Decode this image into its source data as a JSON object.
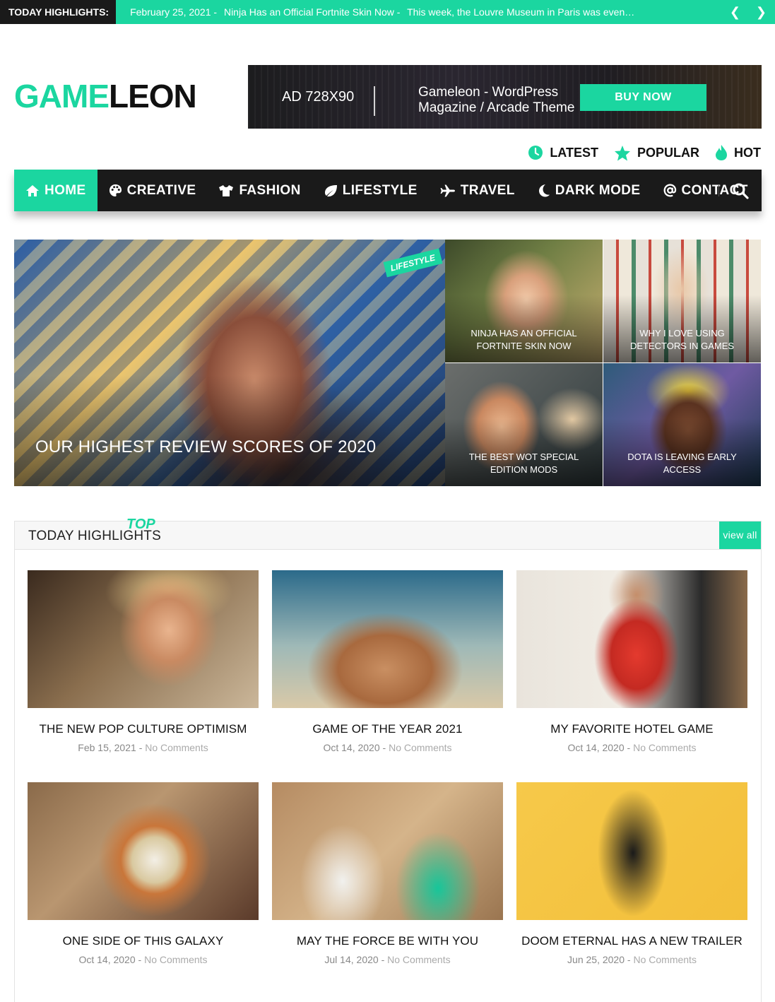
{
  "ticker": {
    "label": "TODAY HIGHLIGHTS:",
    "items": [
      "February 25, 2021 -",
      "Ninja Has an Official Fortnite Skin Now -",
      "This week, the Louvre Museum in Paris was even…"
    ],
    "prev_icon": "chevron-left-icon",
    "next_icon": "chevron-right-icon"
  },
  "logo": {
    "part1": "GAME",
    "part2": "LEON"
  },
  "ad": {
    "size": "AD 728X90",
    "text_line1": "Gameleon - WordPress",
    "text_line2": "Magazine / Arcade Theme",
    "button": "BUY NOW"
  },
  "filters": [
    {
      "label": "LATEST",
      "icon": "clock-icon"
    },
    {
      "label": "POPULAR",
      "icon": "star-icon"
    },
    {
      "label": "HOT",
      "icon": "flame-icon"
    }
  ],
  "nav": {
    "items": [
      {
        "label": "HOME",
        "icon": "home-icon",
        "active": true
      },
      {
        "label": "CREATIVE",
        "icon": "palette-icon"
      },
      {
        "label": "FASHION",
        "icon": "shirt-icon"
      },
      {
        "label": "LIFESTYLE",
        "icon": "leaf-icon"
      },
      {
        "label": "TRAVEL",
        "icon": "plane-icon"
      },
      {
        "label": "DARK MODE",
        "icon": "moon-icon"
      },
      {
        "label": "CONTACT",
        "icon": "at-icon"
      }
    ],
    "search_icon": "search-icon"
  },
  "featured": {
    "main": {
      "badge": "LIFESTYLE",
      "title": "OUR HIGHEST REVIEW SCORES OF 2020"
    },
    "side": [
      {
        "title": "NINJA HAS AN OFFICIAL FORTNITE SKIN NOW"
      },
      {
        "title": "WHY I LOVE USING DETECTORS IN GAMES"
      },
      {
        "title": "THE BEST WOT SPECIAL EDITION MODS"
      },
      {
        "title": "DOTA IS LEAVING EARLY ACCESS"
      }
    ]
  },
  "highlights": {
    "title": "TODAY HIGHLIGHTS",
    "tag": "TOP",
    "view_all": "view all",
    "posts": [
      {
        "title": "THE NEW POP CULTURE OPTIMISM",
        "date": "Feb 15, 2021",
        "sep": "-",
        "comments": "No Comments"
      },
      {
        "title": "GAME OF THE YEAR 2021",
        "date": "Oct 14, 2020",
        "sep": "-",
        "comments": "No Comments"
      },
      {
        "title": "MY FAVORITE HOTEL GAME",
        "date": "Oct 14, 2020",
        "sep": "-",
        "comments": "No Comments"
      },
      {
        "title": "ONE SIDE OF THIS GALAXY",
        "date": "Oct 14, 2020",
        "sep": "-",
        "comments": "No Comments"
      },
      {
        "title": "MAY THE FORCE BE WITH YOU",
        "date": "Jul 14, 2020",
        "sep": "-",
        "comments": "No Comments"
      },
      {
        "title": "DOOM ETERNAL HAS A NEW TRAILER",
        "date": "Jun 25, 2020",
        "sep": "-",
        "comments": "No Comments"
      }
    ]
  },
  "colors": {
    "accent": "#1bd6a0",
    "dark": "#1a1a1a"
  }
}
